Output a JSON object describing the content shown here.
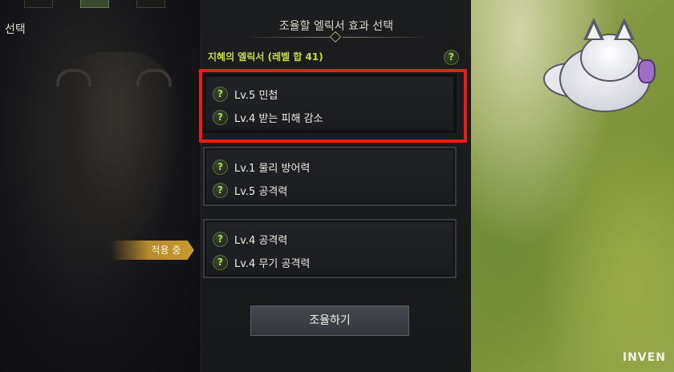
{
  "left": {
    "title": "선택"
  },
  "panel": {
    "subtitle": "조율할 엘릭서 효과 선택",
    "section_title": "지혜의 엘릭서 (레벨 합 41)",
    "help_glyph": "?",
    "cards": [
      {
        "lines": [
          "Lv.5 민첩",
          "Lv.4 받는 피해 감소"
        ],
        "highlighted": true
      },
      {
        "lines": [
          "Lv.1 물리 방어력",
          "Lv.5 공격력"
        ],
        "highlighted": false
      },
      {
        "lines": [
          "Lv.4 공격력",
          "Lv.4 무기 공격력"
        ],
        "highlighted": false,
        "applied": true
      }
    ],
    "applied_badge": "적용 중",
    "button_label": "조율하기"
  },
  "watermark": "INVEN",
  "colors": {
    "highlight": "#ef1b1b",
    "section_title": "#c9dc3a",
    "badge": "#c99a2e"
  }
}
